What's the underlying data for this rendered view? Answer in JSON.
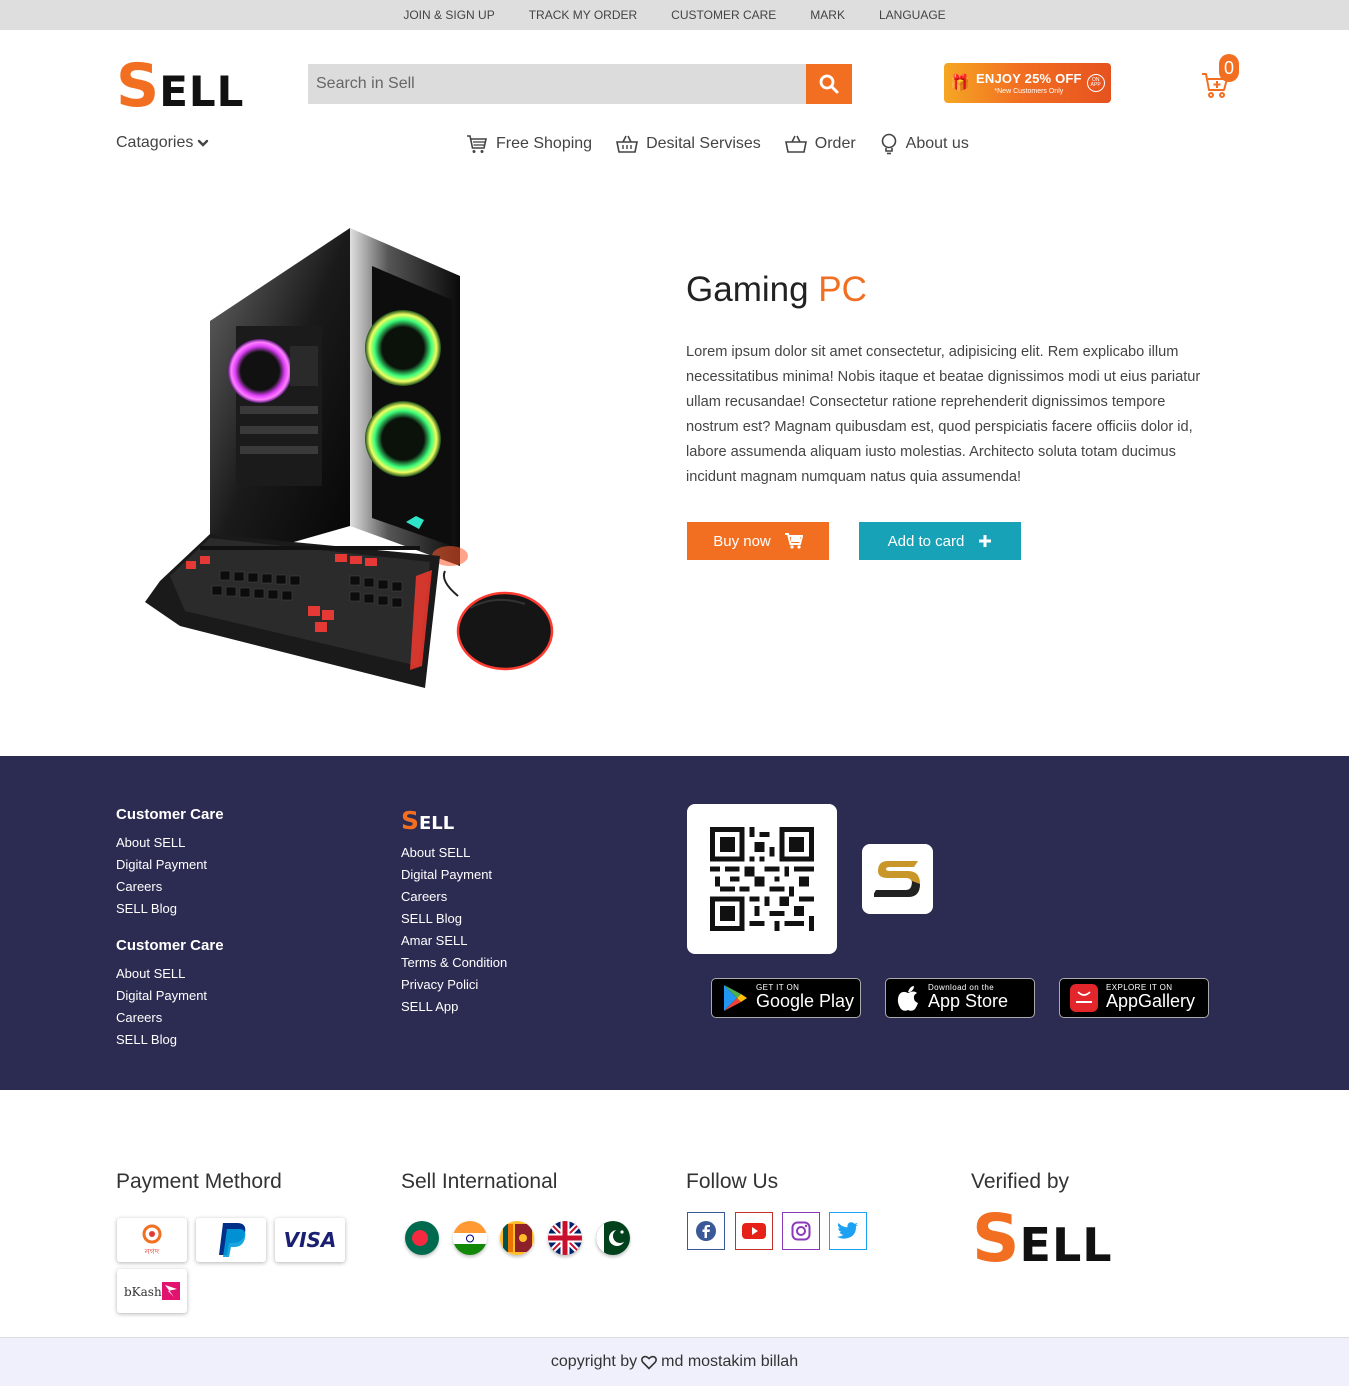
{
  "topbar": {
    "links": [
      "JOIN & SIGN UP",
      "TRACK MY ORDER",
      "CUSTOMER CARE",
      "MARK",
      "LANGUAGE"
    ]
  },
  "header": {
    "logo": {
      "first": "S",
      "rest": "ELL"
    },
    "search_placeholder": "Search in Sell",
    "promo": {
      "headline": "ENJOY 25% OFF",
      "subline": "*New Customers Only",
      "badge": "ON APP"
    },
    "cart_count": "0"
  },
  "nav": {
    "categories": "Catagories",
    "items": [
      "Free Shoping",
      "Desital Servises",
      "Order",
      "About us"
    ]
  },
  "hero": {
    "title_main": "Gaming",
    "title_accent": "PC",
    "description": "Lorem ipsum dolor sit amet consectetur, adipisicing elit. Rem explicabo illum necessitatibus minima! Nobis itaque et beatae dignissimos modi ut eius pariatur ullam recusandae! Consectetur ratione reprehenderit dignissimos tempore nostrum est? Magnam quibusdam est, quod perspiciatis facere officiis dolor id, labore assumenda aliquam iusto molestias. Architecto soluta totam ducimus incidunt magnam numquam natus quia assumenda!",
    "buy_label": "Buy now",
    "add_label": "Add to card"
  },
  "footer": {
    "col1": {
      "title": "Customer Care",
      "links": [
        "About SELL",
        "Digital Payment",
        "Careers",
        "SELL Blog"
      ]
    },
    "col1b": {
      "title": "Customer Care",
      "links": [
        "About SELL",
        "Digital Payment",
        "Careers",
        "SELL Blog"
      ]
    },
    "col2": {
      "logo": {
        "first": "S",
        "rest": "ELL"
      },
      "links": [
        "About SELL",
        "Digital Payment",
        "Careers",
        "SELL Blog",
        "Amar SELL",
        "Terms & Condition",
        "Privacy Polici",
        "SELL App"
      ]
    },
    "stores": [
      {
        "small": "GET IT ON",
        "big": "Google Play",
        "icon": "google-play-icon"
      },
      {
        "small": "Download on the",
        "big": "App Store",
        "icon": "apple-icon"
      },
      {
        "small": "EXPLORE IT ON",
        "big": "AppGallery",
        "icon": "huawei-icon"
      }
    ]
  },
  "bottom": {
    "payment_title": "Payment Methord",
    "payments": [
      "nagad",
      "PayPal",
      "VISA",
      "bKash"
    ],
    "international_title": "Sell International",
    "flags": [
      "bangladesh",
      "india",
      "sri-lanka",
      "united-kingdom",
      "pakistan"
    ],
    "follow_title": "Follow Us",
    "socials": [
      "facebook",
      "youtube",
      "instagram",
      "twitter"
    ],
    "verified_title": "Verified by",
    "verified_logo": {
      "first": "S",
      "rest": "ELL"
    }
  },
  "copyright": {
    "prefix": "copyright by",
    "name": "md mostakim billah"
  },
  "colors": {
    "accent": "#f26f22",
    "teal": "#17a2b8",
    "footer_bg": "#2c2b52",
    "topbar_bg": "#dedede"
  }
}
